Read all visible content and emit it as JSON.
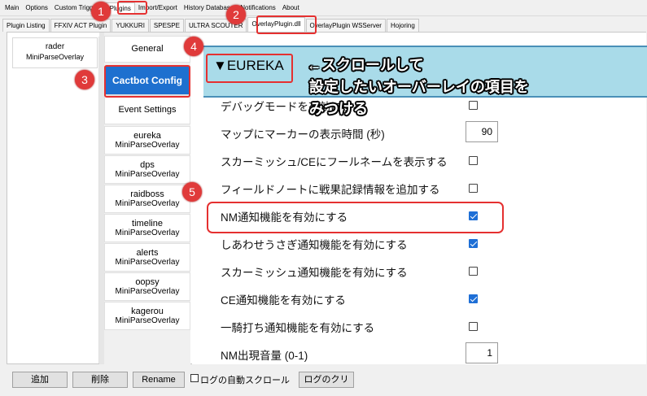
{
  "menu": [
    "Main",
    "Options",
    "Custom Triggers",
    "Plugins",
    "Import/Export",
    "History Database",
    "Notifications",
    "About"
  ],
  "menu_active": "Plugins",
  "subtabs": [
    "Plugin Listing",
    "FFXIV ACT Plugin",
    "YUKKURI",
    "SPESPE",
    "ULTRA SCOUTER",
    "OverlayPlugin.dll",
    "OverlayPlugin WSServer",
    "Hojoring"
  ],
  "subtab_active": "OverlayPlugin.dll",
  "left": {
    "name": "rader",
    "type": "MiniParseOverlay"
  },
  "nav": {
    "general": "General",
    "cactbot": "Cactbot Config",
    "event": "Event Settings",
    "items": [
      {
        "name": "eureka",
        "type": "MiniParseOverlay"
      },
      {
        "name": "dps",
        "type": "MiniParseOverlay"
      },
      {
        "name": "raidboss",
        "type": "MiniParseOverlay"
      },
      {
        "name": "timeline",
        "type": "MiniParseOverlay"
      },
      {
        "name": "alerts",
        "type": "MiniParseOverlay"
      },
      {
        "name": "oopsy",
        "type": "MiniParseOverlay"
      },
      {
        "name": "kagerou",
        "type": "MiniParseOverlay"
      }
    ]
  },
  "section_title": "▼EUREKA",
  "rows": [
    {
      "label": "デバッグモードを有効にする",
      "checked": false
    },
    {
      "label": "マップにマーカーの表示時間 (秒)",
      "value": "90"
    },
    {
      "label": "スカーミッシュ/CEにフールネームを表示する",
      "checked": false
    },
    {
      "label": "フィールドノートに戦果記録情報を追加する",
      "checked": false
    },
    {
      "label": "NM通知機能を有効にする",
      "checked": true
    },
    {
      "label": "しあわせうさぎ通知機能を有効にする",
      "checked": true
    },
    {
      "label": "スカーミッシュ通知機能を有効にする",
      "checked": false
    },
    {
      "label": "CE通知機能を有効にする",
      "checked": true
    },
    {
      "label": "一騎打ち通知機能を有効にする",
      "checked": false
    },
    {
      "label": "NM出現音量 (0-1)",
      "value": "1"
    }
  ],
  "bottom": {
    "add": "追加",
    "delete": "削除",
    "rename": "Rename",
    "autoscroll": "ログの自動スクロール",
    "clear": "ログのクリ"
  },
  "annotations": {
    "steps": [
      "1",
      "2",
      "3",
      "4",
      "5"
    ],
    "note_line1": "←スクロールして",
    "note_line2": "設定したいオーバーレイの項目を",
    "note_line3": "みつける"
  },
  "colors": {
    "accent": "#1e70cf",
    "annotation": "#e03a3a",
    "eureka_bar": "#a9dbe9"
  }
}
